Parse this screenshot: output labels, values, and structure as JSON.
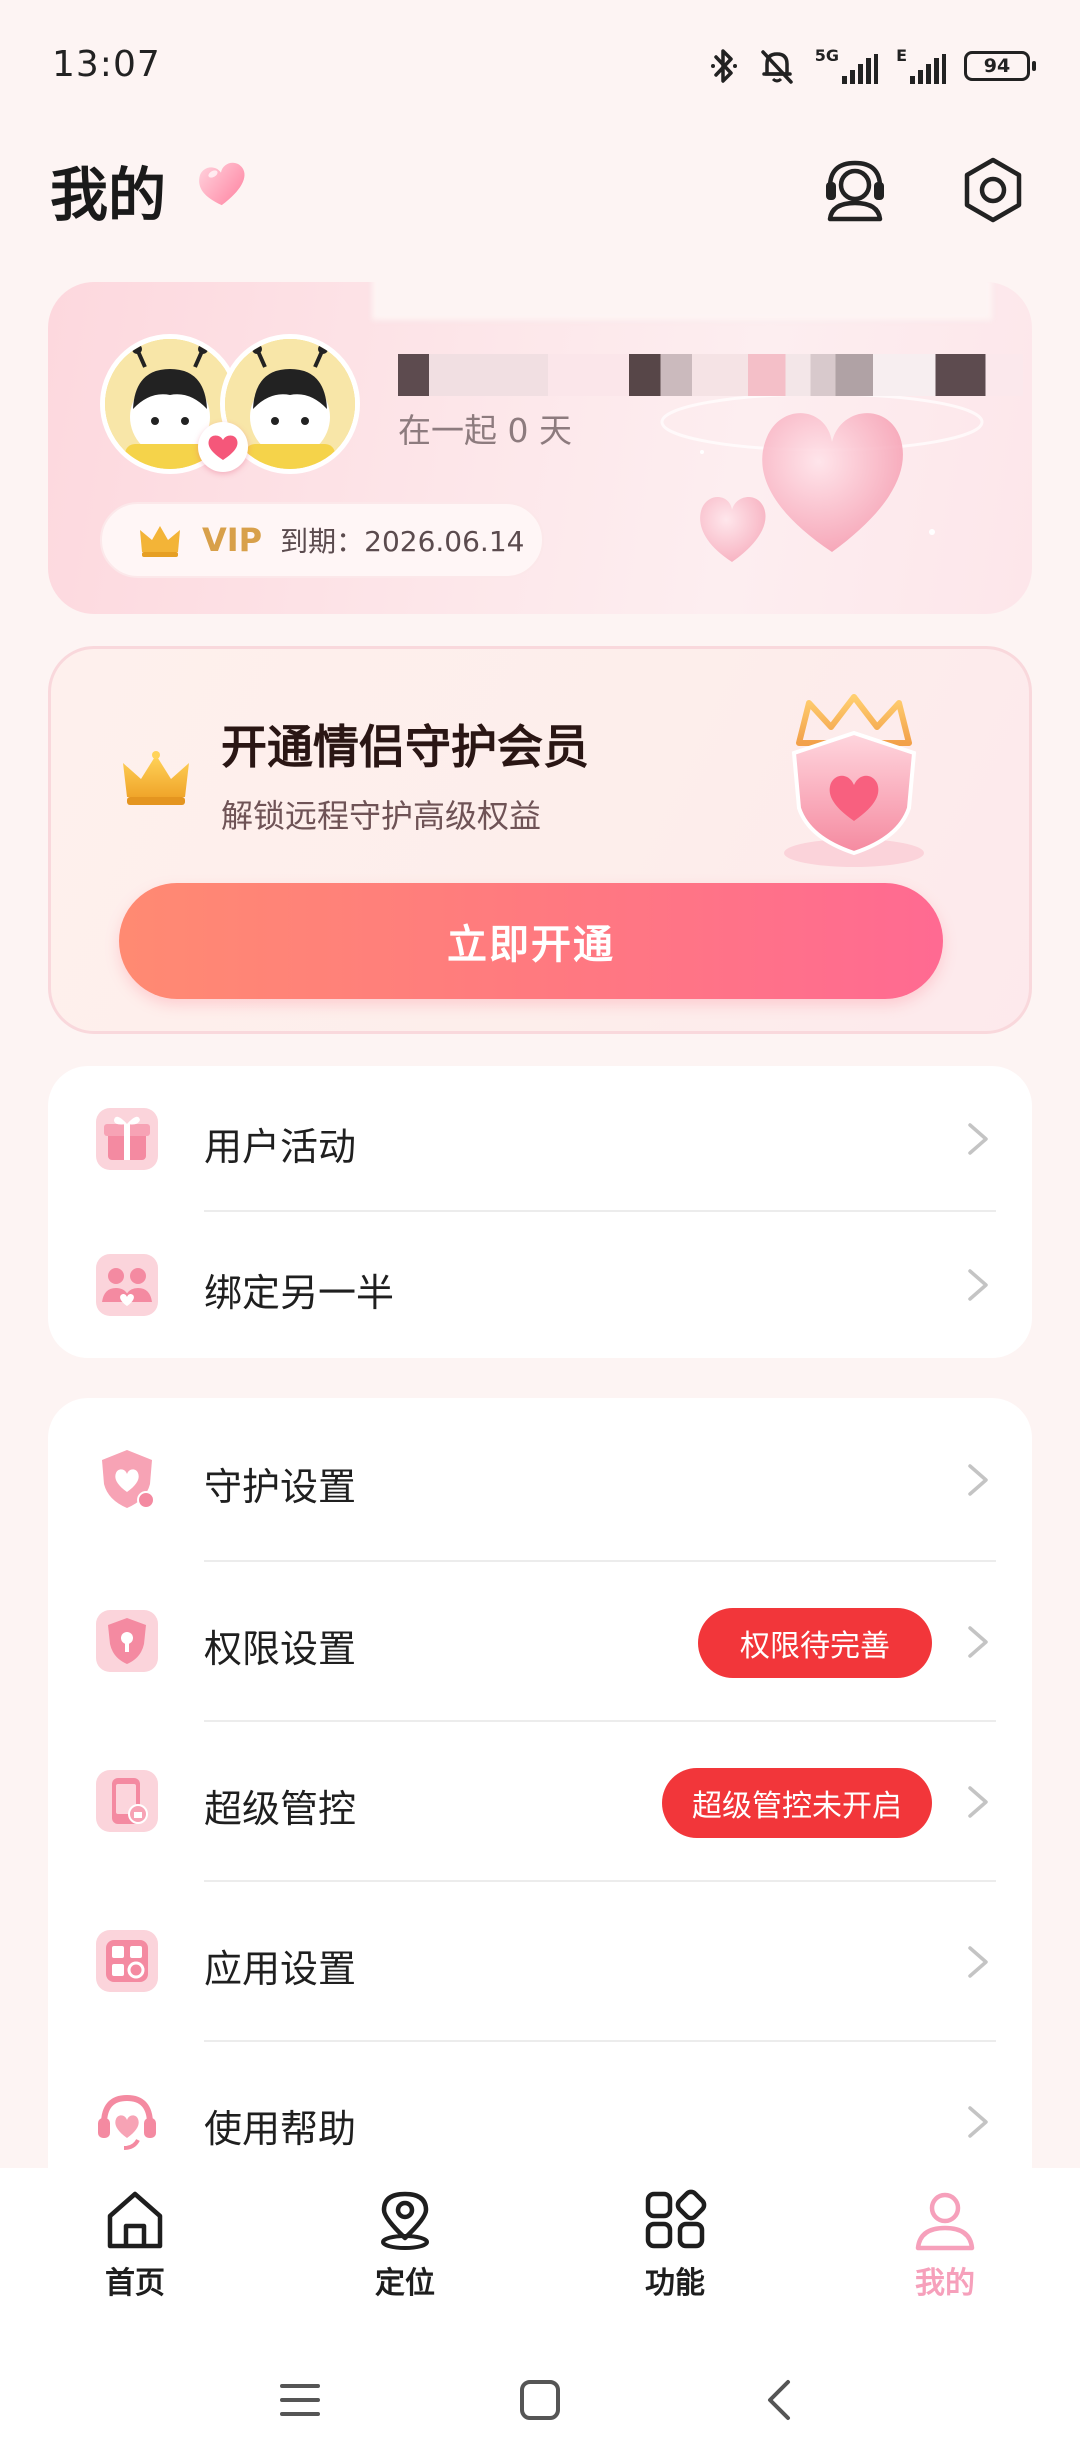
{
  "status_bar": {
    "time": "13:07",
    "battery": "94",
    "network_label": "5G",
    "network_label_2": "E"
  },
  "header": {
    "title": "我的"
  },
  "profile": {
    "together_days": "在一起 0 天",
    "vip_label": "VIP",
    "vip_expiry": "到期：2026.06.14"
  },
  "promo": {
    "title": "开通情侣守护会员",
    "subtitle": "解锁远程守护高级权益",
    "button": "立即开通"
  },
  "menu_group_1": [
    {
      "label": "用户活动",
      "icon": "gift-icon"
    },
    {
      "label": "绑定另一半",
      "icon": "couple-icon"
    }
  ],
  "menu_group_2": [
    {
      "label": "守护设置",
      "icon": "shield-heart-icon",
      "badge": ""
    },
    {
      "label": "权限设置",
      "icon": "shield-lock-icon",
      "badge": "权限待完善"
    },
    {
      "label": "超级管控",
      "icon": "phone-lock-icon",
      "badge": "超级管控未开启"
    },
    {
      "label": "应用设置",
      "icon": "app-settings-icon",
      "badge": ""
    },
    {
      "label": "使用帮助",
      "icon": "headset-heart-icon",
      "badge": ""
    }
  ],
  "bottom_nav": [
    {
      "label": "首页",
      "icon": "home-icon",
      "active": false
    },
    {
      "label": "定位",
      "icon": "location-icon",
      "active": false
    },
    {
      "label": "功能",
      "icon": "grid-icon",
      "active": false
    },
    {
      "label": "我的",
      "icon": "person-icon",
      "active": true
    }
  ],
  "colors": {
    "accent_pink": "#f6a0bb",
    "badge_red": "#f2363a",
    "button_gradient_start": "#ff8a72",
    "button_gradient_end": "#ff6a92",
    "vip_gold": "#d8a04a"
  }
}
